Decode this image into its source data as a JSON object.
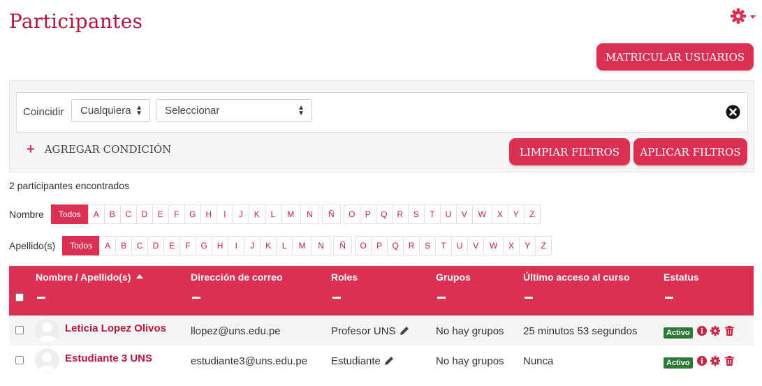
{
  "page": {
    "title": "Participantes",
    "enroll_button": "MATRICULAR USUARIOS"
  },
  "filters": {
    "match_label": "Coincidir",
    "match_value": "Cualquiera",
    "condition_value": "Seleccionar",
    "add_condition": "AGREGAR CONDICIÓN",
    "clear_button": "LIMPIAR FILTROS",
    "apply_button": "APLICAR FILTROS"
  },
  "results": {
    "count_text": "2 participantes encontrados"
  },
  "initials": {
    "first_label": "Nombre",
    "last_label": "Apellido(s)",
    "all_label": "Todos",
    "letters": [
      "A",
      "B",
      "C",
      "D",
      "E",
      "F",
      "G",
      "H",
      "I",
      "J",
      "K",
      "L",
      "M",
      "N",
      "Ñ",
      "O",
      "P",
      "Q",
      "R",
      "S",
      "T",
      "U",
      "V",
      "W",
      "X",
      "Y",
      "Z"
    ]
  },
  "table": {
    "headers": {
      "name": "Nombre / Apellido(s)",
      "email": "Dirección de correo",
      "roles": "Roles",
      "groups": "Grupos",
      "last_access": "Último acceso al curso",
      "status": "Estatus"
    },
    "rows": [
      {
        "name": "Leticia Lopez Olivos",
        "email": "llopez@uns.edu.pe",
        "role": "Profesor UNS",
        "groups": "No hay grupos",
        "last_access": "25 minutos 53 segundos",
        "status": "Activo"
      },
      {
        "name": "Estudiante 3 UNS",
        "email": "estudiante3@uns.edu.pe",
        "role": "Estudiante",
        "groups": "No hay grupos",
        "last_access": "Nunca",
        "status": "Activo"
      }
    ]
  },
  "colors": {
    "brand": "#d93054",
    "brand_text": "#b5163b",
    "active_badge": "#2d7a36"
  }
}
